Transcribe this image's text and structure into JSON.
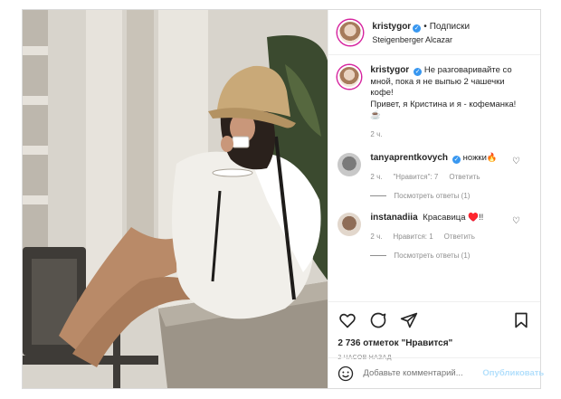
{
  "post": {
    "username": "kristygor",
    "follow_label": "Подписки",
    "location": "Steigenberger Alcazar"
  },
  "caption": {
    "username": "kristygor",
    "text_line1": "Не разговаривайте со мной, пока я не выпью 2 чашечки кофе!",
    "text_line2": "Привет, я Кристина и я - кофеманка!",
    "emoji": "☕",
    "age": "2 ч."
  },
  "comments": [
    {
      "username": "tanyaprentkovych",
      "text": "ножки🔥",
      "age": "2 ч.",
      "likes": "\"Нравится\": 7",
      "reply_label": "Ответить",
      "show_replies": "Посмотреть ответы (1)",
      "verified": true
    },
    {
      "username": "instanadiia",
      "text": "Красавица ♥️!!",
      "age": "2 ч.",
      "likes": "Нравится: 1",
      "reply_label": "Ответить",
      "show_replies": "Посмотреть ответы (1)",
      "verified": false
    }
  ],
  "stats": {
    "likes": "2 736 отметок \"Нравится\"",
    "posted": "2 ЧАСОВ НАЗАД"
  },
  "compose": {
    "placeholder": "Добавьте комментарий...",
    "publish_label": "Опубликовать"
  },
  "icons": {
    "like": "heart-icon",
    "comment": "comment-icon",
    "share": "paper-plane-icon",
    "save": "bookmark-icon",
    "emoji": "smiley-icon"
  },
  "colors": {
    "verified": "#3897f0",
    "story_ring": "#d6249f",
    "publish_disabled": "#b2dffc",
    "muted": "#8e8e8e"
  }
}
